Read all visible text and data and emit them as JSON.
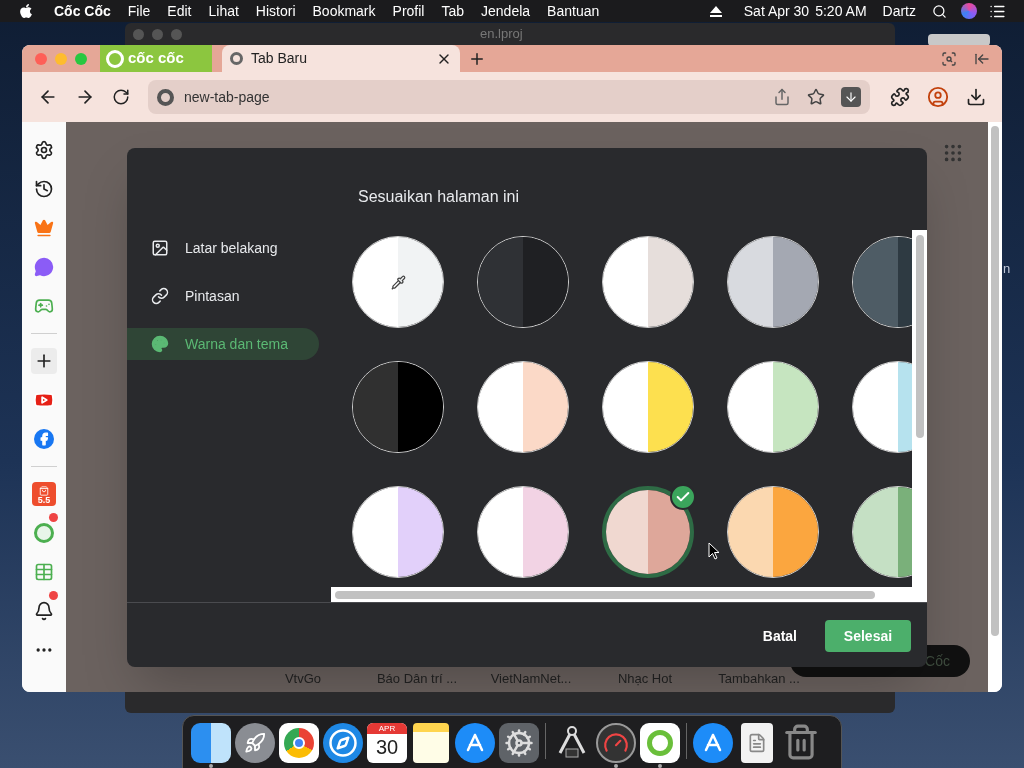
{
  "menu_bar": {
    "app_name": "Cốc Cốc",
    "menus": [
      "File",
      "Edit",
      "Lihat",
      "Histori",
      "Bookmark",
      "Profil",
      "Tab",
      "Jendela",
      "Bantuan"
    ],
    "date": "Sat Apr 30",
    "time": "5:20 AM",
    "user": "Dartz"
  },
  "background_window": {
    "title": "en.lproj"
  },
  "desktop": {
    "partial_label": "n"
  },
  "browser": {
    "brand": "cốc cốc",
    "tabs": [
      {
        "title": "Tab Baru",
        "selected": true
      }
    ],
    "address": "new-tab-page"
  },
  "sidebar": {
    "items": [
      {
        "kind": "settings",
        "dot": false
      },
      {
        "kind": "history",
        "dot": false
      },
      {
        "kind": "crown",
        "dot": false
      },
      {
        "kind": "messenger",
        "dot": false
      },
      {
        "kind": "game",
        "dot": false
      },
      {
        "kind": "divider"
      },
      {
        "kind": "add",
        "dot": false
      },
      {
        "kind": "youtube",
        "dot": false
      },
      {
        "kind": "facebook",
        "dot": false
      },
      {
        "kind": "divider"
      },
      {
        "kind": "shop",
        "dot": false,
        "label": "5.5"
      },
      {
        "kind": "browser",
        "dot": true
      },
      {
        "kind": "sheet",
        "dot": false
      },
      {
        "kind": "bell",
        "dot": true
      },
      {
        "kind": "more",
        "dot": false
      }
    ]
  },
  "shortcuts": [
    "VtvGo",
    "Báo Dân trí ...",
    "VietNamNet...",
    "Nhạc Hot",
    "Tambahkan ..."
  ],
  "search_pill": {
    "text": "Cốc"
  },
  "dialog": {
    "title": "Sesuaikan halaman ini",
    "nav": [
      {
        "label": "Latar belakang",
        "kind": "background",
        "selected": false
      },
      {
        "label": "Pintasan",
        "kind": "shortcuts",
        "selected": false
      },
      {
        "label": "Warna dan tema",
        "kind": "theme",
        "selected": true
      }
    ],
    "swatches": [
      [
        {
          "kind": "custom",
          "halves": [
            {
              "color": "#ffffff"
            },
            {
              "color": "#f1f3f4"
            }
          ],
          "selected": false
        },
        {
          "kind": "color",
          "halves": [
            {
              "color": "#2f3135"
            },
            {
              "color": "#1f2023"
            }
          ],
          "selected": false
        },
        {
          "kind": "color",
          "halves": [
            {
              "color": "#ffffff"
            },
            {
              "color": "#e6dedb"
            }
          ],
          "selected": false
        },
        {
          "kind": "color",
          "halves": [
            {
              "color": "#d8dadf"
            },
            {
              "color": "#a4a8b2"
            }
          ],
          "selected": false
        },
        {
          "kind": "color",
          "halves": [
            {
              "color": "#4e5c65"
            },
            {
              "color": "#2e3a42"
            }
          ],
          "selected": false
        }
      ],
      [
        {
          "kind": "color",
          "halves": [
            {
              "color": "#303030"
            },
            {
              "color": "#000000"
            }
          ],
          "selected": false
        },
        {
          "kind": "color",
          "halves": [
            {
              "color": "#ffffff"
            },
            {
              "color": "#fbd9c7"
            }
          ],
          "selected": false
        },
        {
          "kind": "color",
          "halves": [
            {
              "color": "#ffffff"
            },
            {
              "color": "#fde04f"
            }
          ],
          "selected": false
        },
        {
          "kind": "color",
          "halves": [
            {
              "color": "#ffffff"
            },
            {
              "color": "#c6e5c0"
            }
          ],
          "selected": false
        },
        {
          "kind": "color",
          "halves": [
            {
              "color": "#ffffff"
            },
            {
              "color": "#b6e2ee"
            }
          ],
          "selected": false
        }
      ],
      [
        {
          "kind": "color",
          "halves": [
            {
              "color": "#ffffff"
            },
            {
              "color": "#e2d0fa"
            }
          ],
          "selected": false
        },
        {
          "kind": "color",
          "halves": [
            {
              "color": "#ffffff"
            },
            {
              "color": "#f2d3e4"
            }
          ],
          "selected": false
        },
        {
          "kind": "color",
          "halves": [
            {
              "color": "#f0d8d0"
            },
            {
              "color": "#dea79a"
            }
          ],
          "selected": true
        },
        {
          "kind": "color",
          "halves": [
            {
              "color": "#fbd8b0"
            },
            {
              "color": "#fba63f"
            }
          ],
          "selected": false
        },
        {
          "kind": "color",
          "halves": [
            {
              "color": "#c5e0c4"
            },
            {
              "color": "#7ab07a"
            }
          ],
          "selected": false
        }
      ]
    ],
    "cancel": "Batal",
    "done": "Selesai"
  },
  "dock": {
    "items": [
      {
        "kind": "finder",
        "running": true
      },
      {
        "kind": "launchpad",
        "running": false
      },
      {
        "kind": "chrome",
        "running": false
      },
      {
        "kind": "safari",
        "running": false
      },
      {
        "kind": "calendar",
        "running": false,
        "month": "APR",
        "day": "30"
      },
      {
        "kind": "notes",
        "running": false
      },
      {
        "kind": "appstore",
        "running": false
      },
      {
        "kind": "settings",
        "running": false
      },
      {
        "kind": "divider"
      },
      {
        "kind": "calipers",
        "running": false
      },
      {
        "kind": "colormeter",
        "running": true
      },
      {
        "kind": "coccoc",
        "running": true
      },
      {
        "kind": "divider"
      },
      {
        "kind": "appstore",
        "running": false
      },
      {
        "kind": "file",
        "running": false
      },
      {
        "kind": "trash",
        "running": false
      }
    ]
  }
}
